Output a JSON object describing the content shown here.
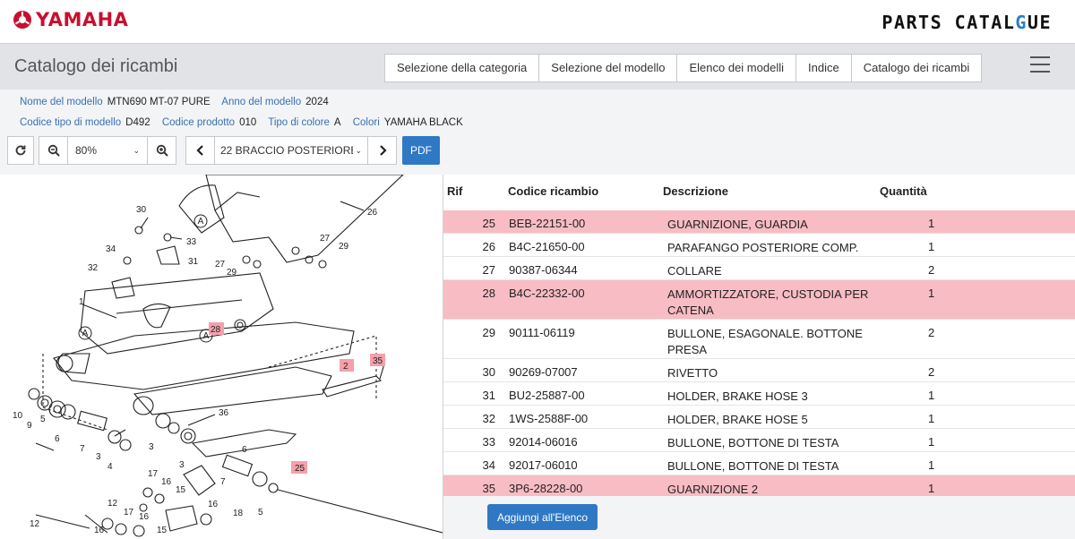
{
  "header": {
    "brand": "YAMAHA",
    "catalogue_title": [
      "PARTS CATAL",
      "G",
      "UE"
    ]
  },
  "titlebar": {
    "title": "Catalogo dei ricambi",
    "nav": [
      "Selezione della categoria",
      "Selezione del modello",
      "Elenco dei modelli",
      "Indice",
      "Catalogo dei ricambi"
    ]
  },
  "info": {
    "model_name_label": "Nome del modello",
    "model_name": "MTN690 MT-07 PURE",
    "year_label": "Anno del modello",
    "year": "2024",
    "type_code_label": "Codice tipo di modello",
    "type_code": "D492",
    "product_code_label": "Codice prodotto",
    "product_code": "010",
    "color_type_label": "Tipo di colore",
    "color_type": "A",
    "colors_label": "Colori",
    "colors": "YAMAHA BLACK"
  },
  "toolbar": {
    "zoom": "80%",
    "page": "22 BRACCIO POSTERIORE",
    "pdf": "PDF"
  },
  "table": {
    "headers": {
      "rif": "Rif",
      "code": "Codice ricambio",
      "desc": "Descrizione",
      "qty": "Quantità"
    },
    "rows": [
      {
        "rif": "25",
        "code": "BEB-22151-00",
        "desc": "GUARNIZIONE, GUARDIA",
        "qty": "1",
        "highlight": true
      },
      {
        "rif": "26",
        "code": "B4C-21650-00",
        "desc": "PARAFANGO POSTERIORE COMP.",
        "qty": "1",
        "highlight": false
      },
      {
        "rif": "27",
        "code": "90387-06344",
        "desc": "COLLARE",
        "qty": "2",
        "highlight": false
      },
      {
        "rif": "28",
        "code": "B4C-22332-00",
        "desc": "AMMORTIZZATORE, CUSTODIA PER CATENA",
        "qty": "1",
        "highlight": true
      },
      {
        "rif": "29",
        "code": "90111-06119",
        "desc": "BULLONE, ESAGONALE. BOTTONE PRESA",
        "qty": "2",
        "highlight": false
      },
      {
        "rif": "30",
        "code": "90269-07007",
        "desc": "RIVETTO",
        "qty": "2",
        "highlight": false
      },
      {
        "rif": "31",
        "code": "BU2-25887-00",
        "desc": "HOLDER, BRAKE HOSE 3",
        "qty": "1",
        "highlight": false
      },
      {
        "rif": "32",
        "code": "1WS-2588F-00",
        "desc": "HOLDER, BRAKE HOSE 5",
        "qty": "1",
        "highlight": false
      },
      {
        "rif": "33",
        "code": "92014-06016",
        "desc": "BULLONE, BOTTONE DI TESTA",
        "qty": "1",
        "highlight": false
      },
      {
        "rif": "34",
        "code": "92017-06010",
        "desc": "BULLONE, BOTTONE DI TESTA",
        "qty": "1",
        "highlight": false
      },
      {
        "rif": "35",
        "code": "3P6-28228-00",
        "desc": "GUARNIZIONE 2",
        "qty": "1",
        "highlight": true
      }
    ],
    "add_button": "Aggiungi all'Elenco"
  },
  "diagram": {
    "labels": [
      "30",
      "26",
      "33",
      "27",
      "29",
      "34",
      "31",
      "32",
      "29",
      "27",
      "1",
      "28",
      "2",
      "35",
      "36",
      "10",
      "9",
      "5",
      "6",
      "7",
      "3",
      "4",
      "3",
      "3",
      "6",
      "25",
      "17",
      "16",
      "15",
      "7",
      "12",
      "17",
      "16",
      "18",
      "5",
      "15",
      "16",
      "12",
      "16"
    ],
    "highlight_labels": [
      "28",
      "2",
      "35",
      "25"
    ],
    "circle_letter": "A"
  },
  "colors": {
    "accent": "#2f78c4",
    "highlight": "#f8bcc4",
    "brand": "#c8102e"
  }
}
